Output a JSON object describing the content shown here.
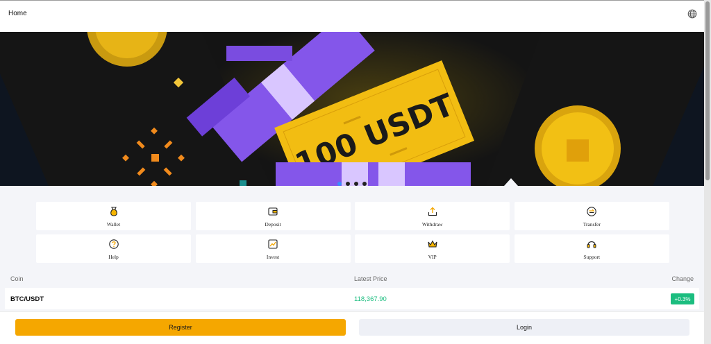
{
  "header": {
    "title": "Home",
    "language_icon": "globe-icon"
  },
  "banner": {
    "ticket_text": "100 USDT",
    "slide_count": 4,
    "active_slide": 1,
    "colors": {
      "background": "#141414",
      "gold": "#f2bd12",
      "purple": "#8a5cf0"
    }
  },
  "quick_actions": [
    {
      "label": "Wallet",
      "icon": "money-bag-icon"
    },
    {
      "label": "Deposit",
      "icon": "wallet-icon"
    },
    {
      "label": "Withdraw",
      "icon": "upload-icon"
    },
    {
      "label": "Transfer",
      "icon": "transfer-icon"
    },
    {
      "label": "Help",
      "icon": "question-icon"
    },
    {
      "label": "Invest",
      "icon": "chart-icon"
    },
    {
      "label": "VIP",
      "icon": "crown-icon"
    },
    {
      "label": "Support",
      "icon": "headset-icon"
    }
  ],
  "market": {
    "columns": {
      "coin": "Coin",
      "price": "Latest Price",
      "change": "Change"
    },
    "rows": [
      {
        "pair": "BTC/USDT",
        "price": "118,367.90",
        "change": "+0.3%"
      }
    ],
    "colors": {
      "up": "#1bbd7f"
    }
  },
  "actions": {
    "register": "Register",
    "login": "Login"
  },
  "colors": {
    "accent": "#f5a700",
    "page_bg": "#f4f5f9"
  }
}
